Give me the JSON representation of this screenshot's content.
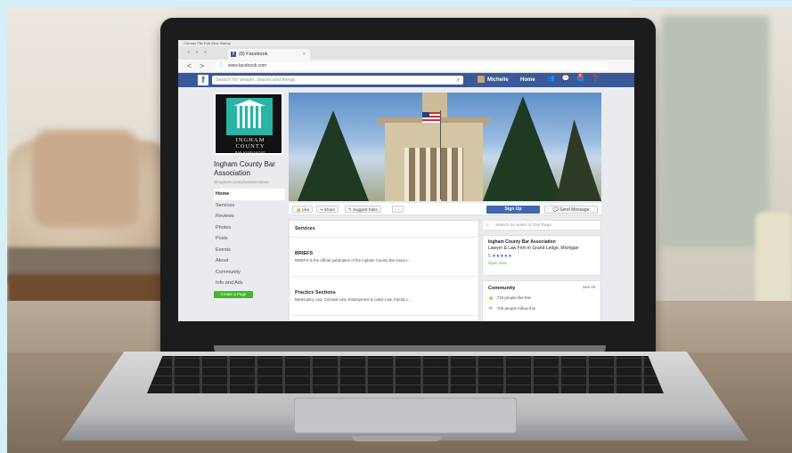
{
  "browser": {
    "menubar": "Chrome   File   Edit   View   History",
    "traffic_lights": "● ● ●",
    "tab_title": "(8) Facebook",
    "tab_close": "×",
    "back": "<",
    "forward": ">",
    "lock": "ⓘ",
    "url": "www.facebook.com"
  },
  "fb_header": {
    "logo": "f",
    "search_placeholder": "Search for people, places and things",
    "search_icon": "⌕",
    "user_name": "Michelle",
    "home": "Home",
    "icons": "👥 💬 🌐 ❓",
    "notification_count": "8"
  },
  "profile": {
    "logo_line1": "INGHAM",
    "logo_line2": "COUNTY",
    "logo_line3": "BAR ASSOCIATION",
    "page_name": "Ingham County Bar Association",
    "handle": "@inghamcountybarassociation"
  },
  "nav": {
    "items": [
      "Home",
      "Services",
      "Reviews",
      "Photos",
      "Posts",
      "Events",
      "About",
      "Community",
      "Info and Ads"
    ],
    "create_page": "Create a Page"
  },
  "actions": {
    "like": "👍 Like",
    "share": "↪ Share",
    "suggest": "✎ Suggest Edits",
    "more": "···",
    "sign_up": "Sign Up",
    "send_message": "💬 Send Message"
  },
  "services": {
    "title": "Services",
    "items": [
      {
        "name": "BRIEFS",
        "desc": "BRIEFS is the official publication of the Ingham County Bar Associ..."
      },
      {
        "name": "Practice Sections",
        "desc": "Bankruptcy Law, Criminal Law, Employment & Labor Law, Family L..."
      }
    ]
  },
  "sidebar_right": {
    "search_posts": "Search for posts on this Page",
    "search_icon": "⌕",
    "about_name": "Ingham County Bar Association",
    "about_type": "Lawyer & Law Firm in Grand Ledge, Michigan",
    "rating": "5 ★★★★★",
    "open_status": "Open Now",
    "community_title": "Community",
    "see_all": "See All",
    "community_row1": "718 people like this",
    "community_row2": "706 people follow this",
    "like_icon": "👍",
    "follow_icon": "👁"
  }
}
